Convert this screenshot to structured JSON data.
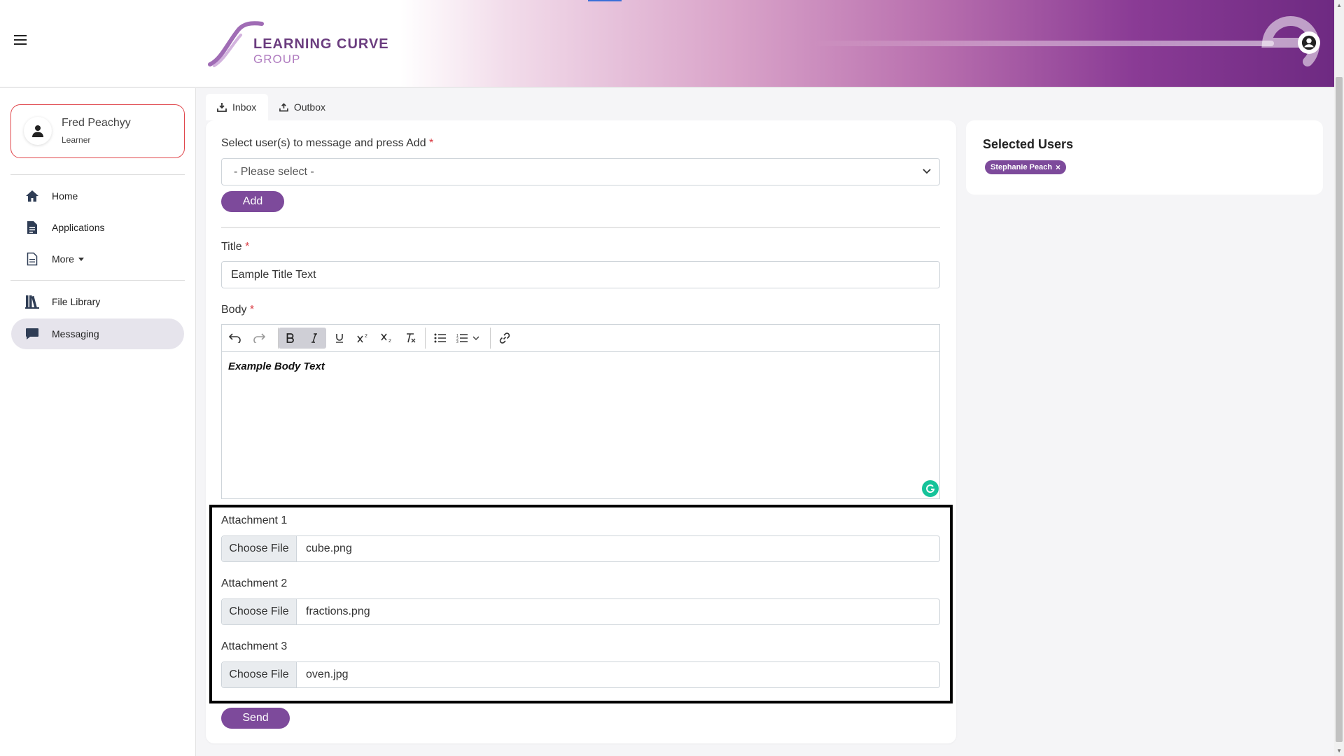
{
  "header": {
    "logo_line1": "LEARNING CURVE",
    "logo_line2": "GROUP"
  },
  "profile": {
    "name": "Fred Peachyy",
    "role": "Learner"
  },
  "nav": {
    "home": "Home",
    "applications": "Applications",
    "more": "More",
    "file_library": "File Library",
    "messaging": "Messaging"
  },
  "tabs": {
    "inbox": "Inbox",
    "outbox": "Outbox"
  },
  "form": {
    "select_label": "Select user(s) to message and press Add",
    "required_mark": "*",
    "select_value": "- Please select -",
    "add_button": "Add",
    "title_label": "Title",
    "title_value": "Eample Title Text",
    "body_label": "Body",
    "body_value": "Example Body Text",
    "send_button": "Send"
  },
  "attachments": [
    {
      "label": "Attachment 1",
      "button": "Choose File",
      "file": "cube.png"
    },
    {
      "label": "Attachment 2",
      "button": "Choose File",
      "file": "fractions.png"
    },
    {
      "label": "Attachment 3",
      "button": "Choose File",
      "file": "oven.jpg"
    }
  ],
  "selected_users": {
    "title": "Selected Users",
    "chips": [
      {
        "name": "Stephanie Peach",
        "remove": "×"
      }
    ]
  },
  "toolbar": {
    "superscript": "2",
    "subscript": "2"
  },
  "colors": {
    "accent": "#7d4a9b",
    "required": "#d9363e",
    "profile_border": "#e0474c",
    "grammarly": "#15c39a"
  }
}
